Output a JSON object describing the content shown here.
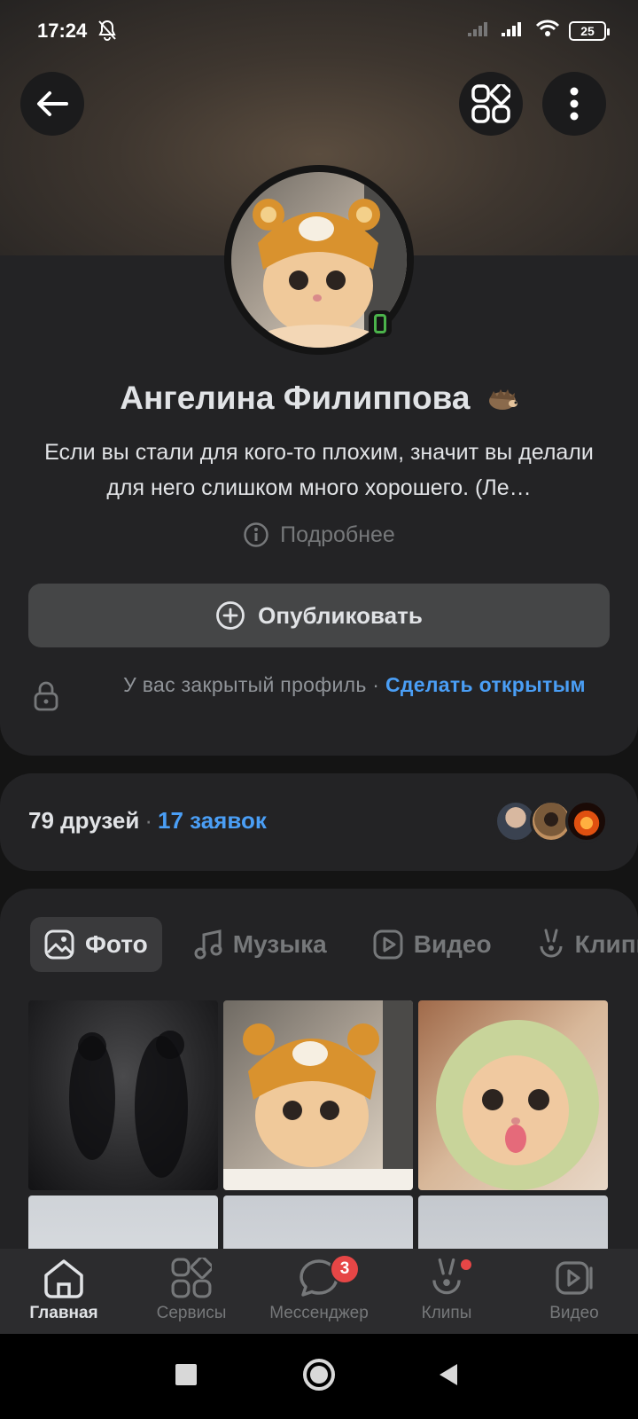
{
  "status_bar": {
    "time": "17:24",
    "battery": "25"
  },
  "header": {
    "back": "back",
    "services": "services",
    "more": "more"
  },
  "profile": {
    "name": "Ангелина Филиппова",
    "status": "Если вы стали для кого-то плохим, значит вы делали для него слишком много хорошего. (Ле…",
    "details_label": "Подробнее",
    "publish_label": "Опубликовать",
    "private_text": "У вас закрытый профиль ·",
    "private_link": "Сделать открытым"
  },
  "friends": {
    "count_label": "79 друзей",
    "separator": "·",
    "requests_label": "17 заявок"
  },
  "media": {
    "tabs": [
      {
        "label": "Фото",
        "active": true
      },
      {
        "label": "Музыка",
        "active": false
      },
      {
        "label": "Видео",
        "active": false
      },
      {
        "label": "Клипы",
        "active": false
      }
    ]
  },
  "bottom_nav": [
    {
      "label": "Главная",
      "active": true
    },
    {
      "label": "Сервисы",
      "active": false
    },
    {
      "label": "Мессенджер",
      "active": false,
      "badge": "3"
    },
    {
      "label": "Клипы",
      "active": false,
      "dot": true
    },
    {
      "label": "Видео",
      "active": false
    }
  ],
  "colors": {
    "accent": "#4a9ef5",
    "online": "#4bb34b",
    "badge": "#e64646",
    "card": "#232325"
  }
}
